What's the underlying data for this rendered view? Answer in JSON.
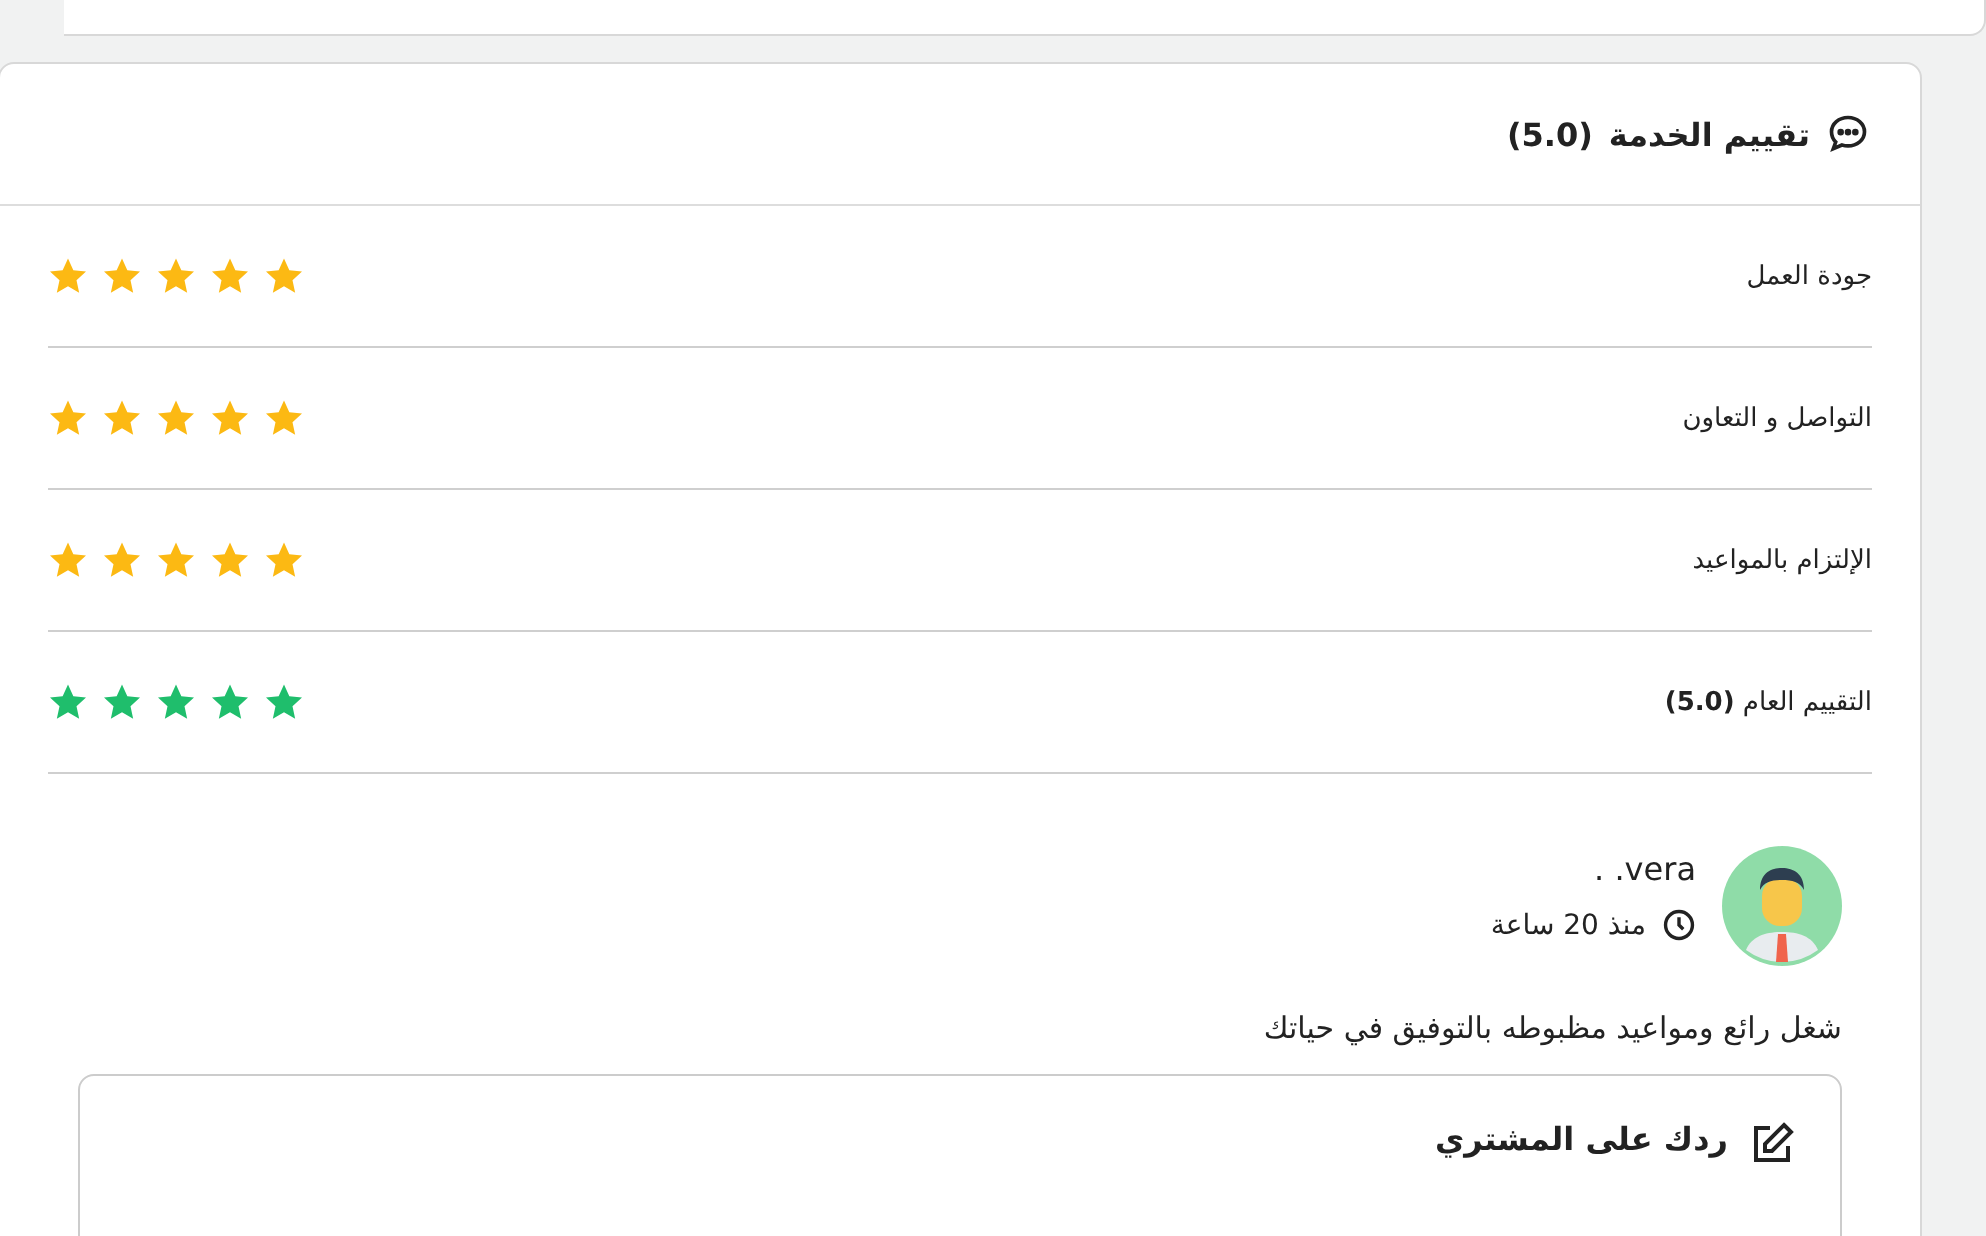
{
  "rating_card": {
    "title": "تقييم الخدمة",
    "score": "(5.0)",
    "criteria": [
      {
        "kind": "criterion",
        "label": "جودة العمل",
        "stars": 5
      },
      {
        "kind": "criterion",
        "label": "التواصل و التعاون",
        "stars": 5
      },
      {
        "kind": "criterion",
        "label": "الإلتزام بالمواعيد",
        "stars": 5
      },
      {
        "kind": "overall",
        "label": "التقييم العام **(5.0)**",
        "stars": 5
      }
    ],
    "review": {
      "name": "vera. .",
      "time": "منذ 20 ساعة",
      "comment": "شغل رائع ومواعيد مظبوطه بالتوفيق في حياتك"
    },
    "reply": {
      "title": "ردك على المشتري"
    }
  }
}
